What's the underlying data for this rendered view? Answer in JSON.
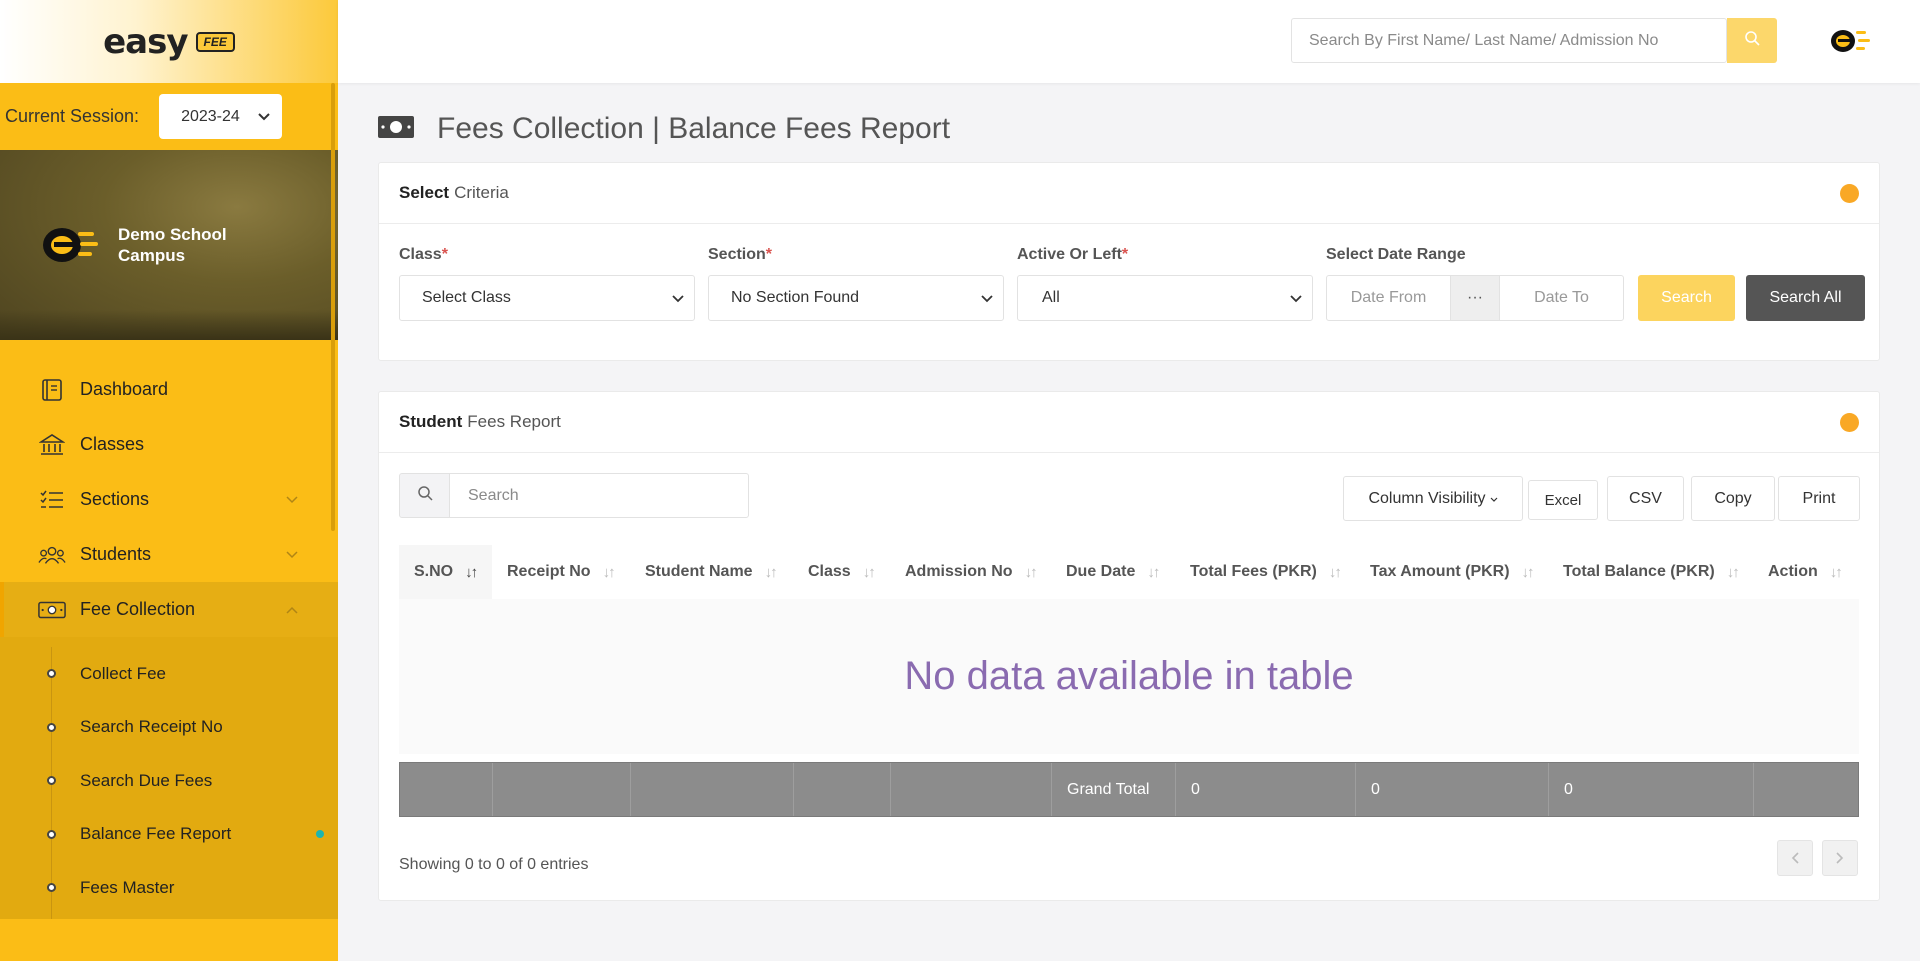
{
  "brand": {
    "logo_text": "easy",
    "logo_badge": "FEE"
  },
  "session": {
    "label": "Current Session:",
    "value": "2023-24"
  },
  "campus": {
    "name_line1": "Demo School",
    "name_line2": "Campus"
  },
  "sidebar": {
    "items": [
      {
        "label": "Dashboard",
        "icon": "dashboard-icon"
      },
      {
        "label": "Classes",
        "icon": "classes-icon"
      },
      {
        "label": "Sections",
        "icon": "sections-icon"
      },
      {
        "label": "Students",
        "icon": "students-icon"
      },
      {
        "label": "Fee Collection",
        "icon": "fee-collection-icon"
      }
    ],
    "submenu": [
      {
        "label": "Collect Fee"
      },
      {
        "label": "Search Receipt No"
      },
      {
        "label": "Search Due Fees"
      },
      {
        "label": "Balance Fee Report"
      },
      {
        "label": "Fees Master"
      }
    ]
  },
  "header": {
    "search_placeholder": "Search By First Name/ Last Name/ Admission No"
  },
  "page": {
    "title": "Fees Collection | Balance Fees Report"
  },
  "criteria": {
    "title_bold": "Select",
    "title_light": "Criteria",
    "class_label": "Class",
    "class_value": "Select Class",
    "section_label": "Section",
    "section_value": "No Section Found",
    "status_label": "Active Or Left",
    "status_value": "All",
    "required_mark": "*",
    "date_range_label": "Select Date Range",
    "date_from_placeholder": "Date From",
    "date_separator": "···",
    "date_to_placeholder": "Date To",
    "search_label": "Search",
    "search_all_label": "Search All"
  },
  "report": {
    "title_bold": "Student",
    "title_light": "Fees Report",
    "search_placeholder": "Search",
    "buttons": {
      "column_visibility": "Column Visibility",
      "excel": "Excel",
      "csv": "CSV",
      "copy": "Copy",
      "print": "Print"
    },
    "columns": [
      "S.NO",
      "Receipt No",
      "Student Name",
      "Class",
      "Admission No",
      "Due Date",
      "Total Fees (PKR)",
      "Tax Amount (PKR)",
      "Total Balance (PKR)",
      "Action"
    ],
    "empty_message": "No data available in table",
    "footer": {
      "grand_total_label": "Grand Total",
      "total_fees": "0",
      "tax_amount": "0",
      "total_balance": "0"
    },
    "showing": "Showing 0 to 0 of 0 entries"
  },
  "colors": {
    "sidebar": "#fbbd16",
    "accent": "#f9a825",
    "empty_text": "#8a6bb0"
  }
}
